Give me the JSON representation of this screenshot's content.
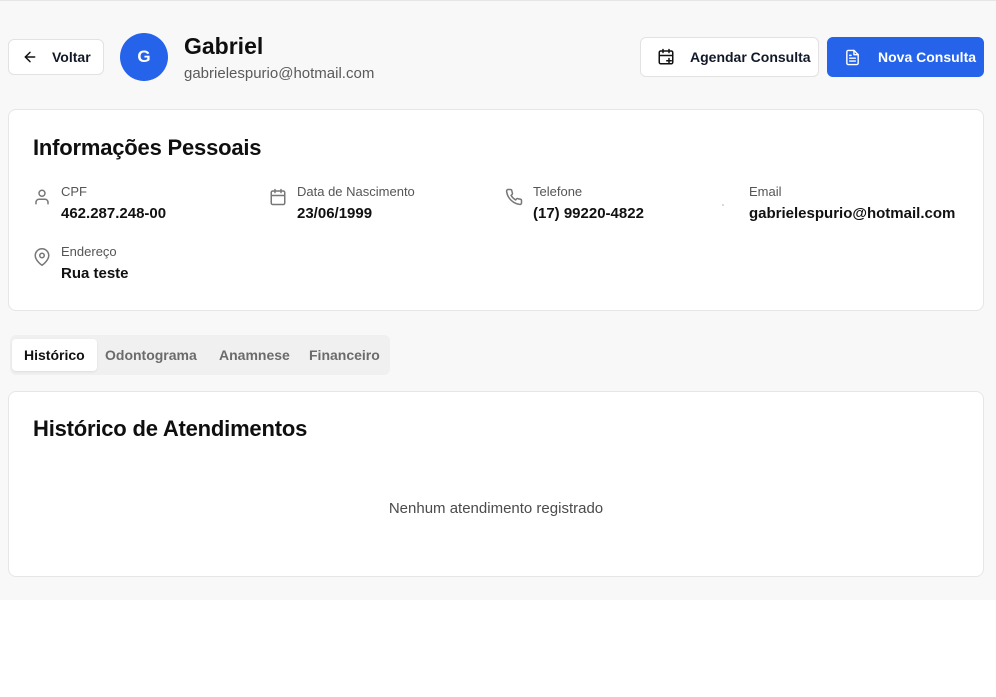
{
  "header": {
    "back_label": "Voltar",
    "avatar_initial": "G",
    "patient_name": "Gabriel",
    "patient_email": "gabrielespurio@hotmail.com",
    "schedule_label": "Agendar Consulta",
    "new_consult_label": "Nova Consulta"
  },
  "personal_info": {
    "title": "Informações Pessoais",
    "fields": [
      {
        "label": "CPF",
        "value": "462.287.248-00",
        "icon": "user-icon"
      },
      {
        "label": "Data de Nascimento",
        "value": "23/06/1999",
        "icon": "calendar-icon"
      },
      {
        "label": "Telefone",
        "value": "(17) 99220-4822",
        "icon": "phone-icon"
      },
      {
        "label": "Email",
        "value": "gabrielespurio@hotmail.com",
        "icon": "mail-icon"
      },
      {
        "label": "Endereço",
        "value": "Rua teste",
        "icon": "map-pin-icon"
      }
    ]
  },
  "tabs": [
    {
      "label": "Histórico",
      "active": true
    },
    {
      "label": "Odontograma",
      "active": false
    },
    {
      "label": "Anamnese",
      "active": false
    },
    {
      "label": "Financeiro",
      "active": false
    }
  ],
  "history": {
    "title": "Histórico de Atendimentos",
    "empty_message": "Nenhum atendimento registrado"
  },
  "colors": {
    "primary": "#2563eb",
    "background": "#f8f8f8",
    "card": "#ffffff"
  }
}
